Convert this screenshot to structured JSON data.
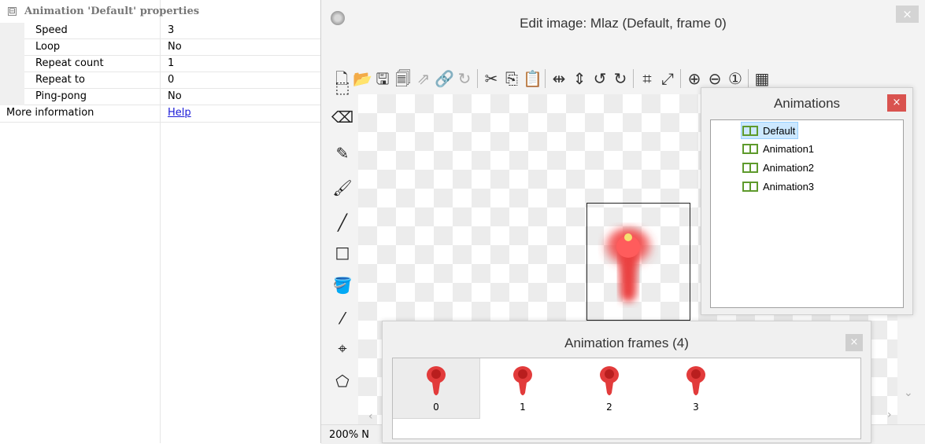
{
  "properties": {
    "header": "Animation 'Default' properties",
    "toggle_symbol": "⊟",
    "rows": [
      {
        "key": "Speed",
        "value": "3"
      },
      {
        "key": "Loop",
        "value": "No"
      },
      {
        "key": "Repeat count",
        "value": "1"
      },
      {
        "key": "Repeat to",
        "value": "0"
      },
      {
        "key": "Ping-pong",
        "value": "No"
      }
    ],
    "more": {
      "key": "More information",
      "value": "Help"
    }
  },
  "editor": {
    "title": "Edit image: Mlaz (Default, frame 0)",
    "close_symbol": "×",
    "zoom_text": "200% N",
    "toolbar_icons": [
      "new-icon",
      "open-icon",
      "save-icon",
      "save-as-icon",
      "export-icon",
      "link-icon",
      "refresh-icon",
      "cut-icon",
      "copy-icon",
      "paste-icon",
      "flip-horizontal-icon",
      "flip-vertical-icon",
      "rotate-left-icon",
      "rotate-right-icon",
      "crop-icon",
      "resize-icon",
      "zoom-in-icon",
      "zoom-out-icon",
      "zoom-reset-icon",
      "grid-icon"
    ],
    "tool_icons": [
      "select-icon",
      "eraser-icon",
      "pencil-icon",
      "brush-icon",
      "line-icon",
      "rectangle-icon",
      "fill-icon",
      "eyedropper-icon",
      "hotspot-icon",
      "action-point-icon"
    ]
  },
  "animations_window": {
    "title": "Animations",
    "close_symbol": "×",
    "items": [
      "Default",
      "Animation1",
      "Animation2",
      "Animation3"
    ],
    "selected": "Default"
  },
  "frames_window": {
    "title": "Animation frames (4)",
    "close_symbol": "×",
    "frames": [
      "0",
      "1",
      "2",
      "3"
    ],
    "selected": "0"
  },
  "colors": {
    "link": "#1b1bd8",
    "sprite": "#e23b3b",
    "anim_icon": "#5e9a2c",
    "selection": "#cce8ff"
  }
}
